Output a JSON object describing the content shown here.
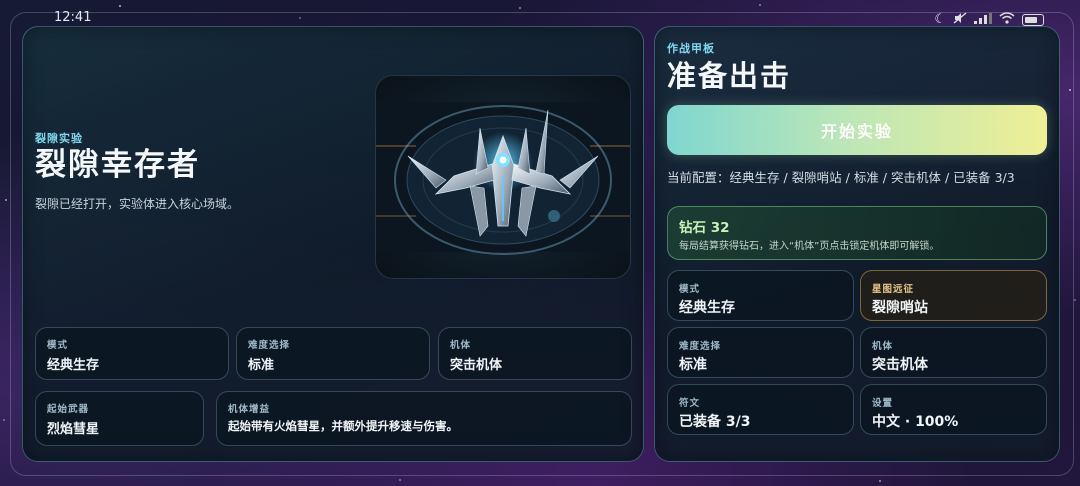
{
  "status_bar": {
    "time": "12:41"
  },
  "left": {
    "eyebrow": "裂隙实验",
    "title": "裂隙幸存者",
    "subtitle": "裂隙已经打开，实验体进入核心场域。",
    "cells": [
      {
        "label": "模式",
        "value": "经典生存"
      },
      {
        "label": "难度选择",
        "value": "标准"
      },
      {
        "label": "机体",
        "value": "突击机体"
      },
      {
        "label": "起始武器",
        "value": "烈焰彗星"
      },
      {
        "label": "机体增益",
        "value": "起始带有火焰彗星，并额外提升移速与伤害。"
      }
    ]
  },
  "right": {
    "eyebrow": "作战甲板",
    "title": "准备出击",
    "start_button": "开始实验",
    "config_line": "当前配置：经典生存 / 裂隙哨站 / 标准 / 突击机体 / 已装备 3/3",
    "diamond": {
      "title": "钻石 32",
      "desc": "每局结算获得钻石，进入“机体”页点击锁定机体即可解锁。"
    },
    "cells": [
      {
        "label": "模式",
        "value": "经典生存"
      },
      {
        "label": "星图远征",
        "value": "裂隙哨站"
      },
      {
        "label": "难度选择",
        "value": "标准"
      },
      {
        "label": "机体",
        "value": "突击机体"
      },
      {
        "label": "符文",
        "value": "已装备 3/3"
      },
      {
        "label": "设置",
        "value": "中文 · 100%"
      }
    ]
  }
}
